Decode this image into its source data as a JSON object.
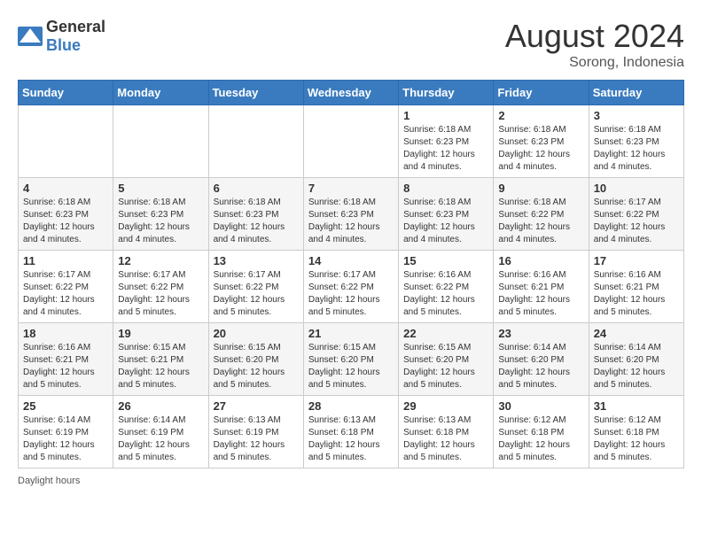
{
  "logo": {
    "general": "General",
    "blue": "Blue"
  },
  "title": {
    "month_year": "August 2024",
    "location": "Sorong, Indonesia"
  },
  "days_header": [
    "Sunday",
    "Monday",
    "Tuesday",
    "Wednesday",
    "Thursday",
    "Friday",
    "Saturday"
  ],
  "weeks": [
    [
      {
        "day": "",
        "info": ""
      },
      {
        "day": "",
        "info": ""
      },
      {
        "day": "",
        "info": ""
      },
      {
        "day": "",
        "info": ""
      },
      {
        "day": "1",
        "info": "Sunrise: 6:18 AM\nSunset: 6:23 PM\nDaylight: 12 hours and 4 minutes."
      },
      {
        "day": "2",
        "info": "Sunrise: 6:18 AM\nSunset: 6:23 PM\nDaylight: 12 hours and 4 minutes."
      },
      {
        "day": "3",
        "info": "Sunrise: 6:18 AM\nSunset: 6:23 PM\nDaylight: 12 hours and 4 minutes."
      }
    ],
    [
      {
        "day": "4",
        "info": "Sunrise: 6:18 AM\nSunset: 6:23 PM\nDaylight: 12 hours and 4 minutes."
      },
      {
        "day": "5",
        "info": "Sunrise: 6:18 AM\nSunset: 6:23 PM\nDaylight: 12 hours and 4 minutes."
      },
      {
        "day": "6",
        "info": "Sunrise: 6:18 AM\nSunset: 6:23 PM\nDaylight: 12 hours and 4 minutes."
      },
      {
        "day": "7",
        "info": "Sunrise: 6:18 AM\nSunset: 6:23 PM\nDaylight: 12 hours and 4 minutes."
      },
      {
        "day": "8",
        "info": "Sunrise: 6:18 AM\nSunset: 6:23 PM\nDaylight: 12 hours and 4 minutes."
      },
      {
        "day": "9",
        "info": "Sunrise: 6:18 AM\nSunset: 6:22 PM\nDaylight: 12 hours and 4 minutes."
      },
      {
        "day": "10",
        "info": "Sunrise: 6:17 AM\nSunset: 6:22 PM\nDaylight: 12 hours and 4 minutes."
      }
    ],
    [
      {
        "day": "11",
        "info": "Sunrise: 6:17 AM\nSunset: 6:22 PM\nDaylight: 12 hours and 4 minutes."
      },
      {
        "day": "12",
        "info": "Sunrise: 6:17 AM\nSunset: 6:22 PM\nDaylight: 12 hours and 5 minutes."
      },
      {
        "day": "13",
        "info": "Sunrise: 6:17 AM\nSunset: 6:22 PM\nDaylight: 12 hours and 5 minutes."
      },
      {
        "day": "14",
        "info": "Sunrise: 6:17 AM\nSunset: 6:22 PM\nDaylight: 12 hours and 5 minutes."
      },
      {
        "day": "15",
        "info": "Sunrise: 6:16 AM\nSunset: 6:22 PM\nDaylight: 12 hours and 5 minutes."
      },
      {
        "day": "16",
        "info": "Sunrise: 6:16 AM\nSunset: 6:21 PM\nDaylight: 12 hours and 5 minutes."
      },
      {
        "day": "17",
        "info": "Sunrise: 6:16 AM\nSunset: 6:21 PM\nDaylight: 12 hours and 5 minutes."
      }
    ],
    [
      {
        "day": "18",
        "info": "Sunrise: 6:16 AM\nSunset: 6:21 PM\nDaylight: 12 hours and 5 minutes."
      },
      {
        "day": "19",
        "info": "Sunrise: 6:15 AM\nSunset: 6:21 PM\nDaylight: 12 hours and 5 minutes."
      },
      {
        "day": "20",
        "info": "Sunrise: 6:15 AM\nSunset: 6:20 PM\nDaylight: 12 hours and 5 minutes."
      },
      {
        "day": "21",
        "info": "Sunrise: 6:15 AM\nSunset: 6:20 PM\nDaylight: 12 hours and 5 minutes."
      },
      {
        "day": "22",
        "info": "Sunrise: 6:15 AM\nSunset: 6:20 PM\nDaylight: 12 hours and 5 minutes."
      },
      {
        "day": "23",
        "info": "Sunrise: 6:14 AM\nSunset: 6:20 PM\nDaylight: 12 hours and 5 minutes."
      },
      {
        "day": "24",
        "info": "Sunrise: 6:14 AM\nSunset: 6:20 PM\nDaylight: 12 hours and 5 minutes."
      }
    ],
    [
      {
        "day": "25",
        "info": "Sunrise: 6:14 AM\nSunset: 6:19 PM\nDaylight: 12 hours and 5 minutes."
      },
      {
        "day": "26",
        "info": "Sunrise: 6:14 AM\nSunset: 6:19 PM\nDaylight: 12 hours and 5 minutes."
      },
      {
        "day": "27",
        "info": "Sunrise: 6:13 AM\nSunset: 6:19 PM\nDaylight: 12 hours and 5 minutes."
      },
      {
        "day": "28",
        "info": "Sunrise: 6:13 AM\nSunset: 6:18 PM\nDaylight: 12 hours and 5 minutes."
      },
      {
        "day": "29",
        "info": "Sunrise: 6:13 AM\nSunset: 6:18 PM\nDaylight: 12 hours and 5 minutes."
      },
      {
        "day": "30",
        "info": "Sunrise: 6:12 AM\nSunset: 6:18 PM\nDaylight: 12 hours and 5 minutes."
      },
      {
        "day": "31",
        "info": "Sunrise: 6:12 AM\nSunset: 6:18 PM\nDaylight: 12 hours and 5 minutes."
      }
    ]
  ],
  "footer": {
    "daylight_label": "Daylight hours"
  }
}
